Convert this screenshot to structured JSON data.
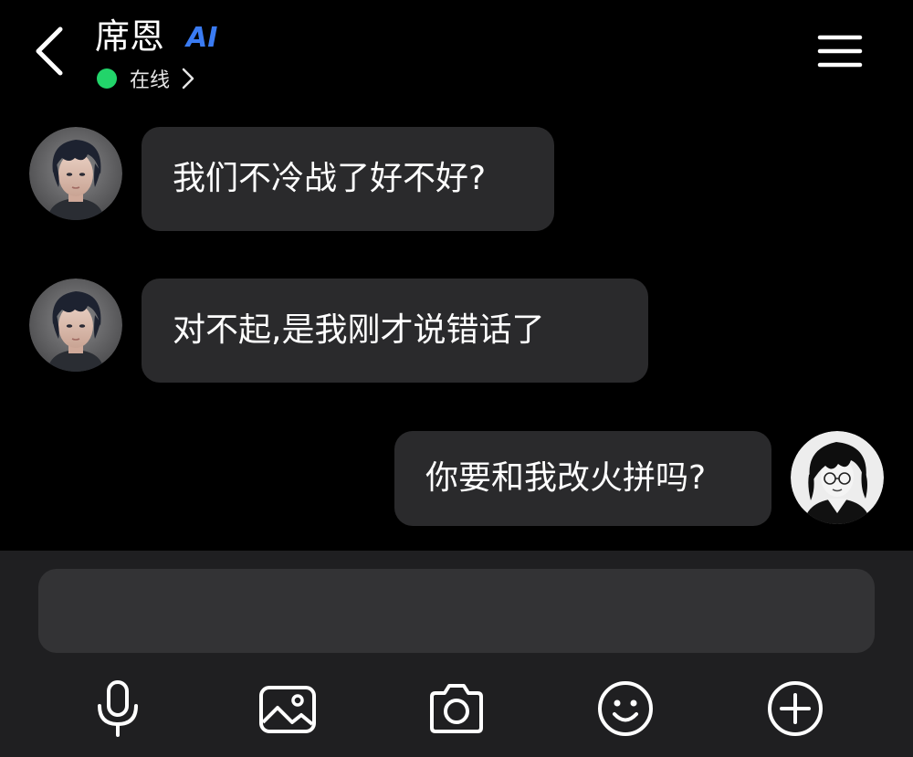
{
  "header": {
    "contact_name": "席恩",
    "ai_badge": "AI",
    "status": "在线",
    "back_icon": "chevron-left-icon",
    "menu_icon": "hamburger-menu-icon"
  },
  "messages": [
    {
      "side": "incoming",
      "text": "我们不冷战了好不好?"
    },
    {
      "side": "incoming",
      "text": "对不起,是我刚才说错话了"
    },
    {
      "side": "outgoing",
      "text": "你要和我改火拼吗?"
    }
  ],
  "input": {
    "value": "",
    "placeholder": ""
  },
  "toolbar": [
    {
      "name": "microphone",
      "icon": "microphone-icon"
    },
    {
      "name": "image",
      "icon": "image-icon"
    },
    {
      "name": "camera",
      "icon": "camera-icon"
    },
    {
      "name": "emoji",
      "icon": "emoji-icon"
    },
    {
      "name": "more",
      "icon": "plus-circle-icon"
    }
  ],
  "colors": {
    "background": "#000000",
    "bubble": "#2a2a2c",
    "online": "#22d46a",
    "ai_badge": "#3a7bf2",
    "bottom_bar": "#1f1f21",
    "input_box": "#333335"
  }
}
